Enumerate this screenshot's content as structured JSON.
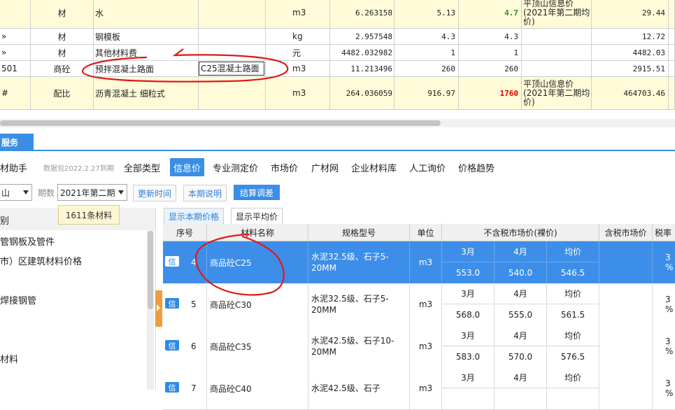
{
  "top_grid": {
    "rows": [
      {
        "code": "",
        "type": "材",
        "name": "水",
        "spec": "",
        "unit": "m3",
        "qty": "6.263158",
        "price1": "5.13",
        "price2": "4.7",
        "source": "平顶山信息价(2021年第二期均价)",
        "amount": "29.44",
        "highlight": true
      },
      {
        "code": "»",
        "type": "材",
        "name": "钢模板",
        "spec": "",
        "unit": "kg",
        "qty": "2.957548",
        "price1": "4.3",
        "price2": "4.3",
        "source": "",
        "amount": "12.72",
        "highlight": false
      },
      {
        "code": "»",
        "type": "材",
        "name": "其他材料费",
        "spec": "",
        "unit": "元",
        "qty": "4482.032982",
        "price1": "1",
        "price2": "1",
        "source": "",
        "amount": "4482.03",
        "highlight": false
      },
      {
        "code": "501",
        "type": "商砼",
        "name": "预拌混凝土路面",
        "spec": "C25混凝土路面",
        "unit": "m3",
        "qty": "11.213496",
        "price1": "260",
        "price2": "260",
        "source": "",
        "amount": "2915.51",
        "highlight": false
      },
      {
        "code": "#",
        "type": "配比",
        "name": "沥青混凝土 细粒式",
        "spec": "",
        "unit": "m3",
        "qty": "264.036059",
        "price1": "916.97",
        "price2": "1760",
        "source": "平顶山信息价(2021年第二期均价)",
        "amount": "464703.46",
        "highlight": true
      }
    ]
  },
  "service": {
    "tab_label": "服务",
    "helper_label": "材助手",
    "package_note": "数据包2022.2.27到期",
    "tabs": [
      "全部类型",
      "信息价",
      "专业测定价",
      "市场价",
      "广材网",
      "企业材料库",
      "人工询价",
      "价格趋势"
    ],
    "active_tab": "信息价",
    "period_label": "期数",
    "period_value": "2021年第二期",
    "region_value": "山",
    "update_time_btn": "更新时间",
    "period_note_btn": "本期说明",
    "settle_btn": "结算调差",
    "tooltip": "1611条材料",
    "category_header": "别",
    "tree_items": [
      "管钢板及管件",
      "市）区建筑材料价格",
      "焊接钢管",
      "材料"
    ],
    "subtabs": [
      "显示本期价格",
      "显示平均价"
    ],
    "active_subtab": "显示本期价格"
  },
  "price_grid": {
    "headers": {
      "seq": "序号",
      "name": "材料名称",
      "spec": "规格型号",
      "unit": "单位",
      "market_excl": "不含税市场价(裸价)",
      "market_incl": "含税市场价",
      "tax": "税率"
    },
    "month_labels": [
      "3月",
      "4月",
      "均价"
    ],
    "badge": "信",
    "rows": [
      {
        "seq": "4",
        "name": "商品砼C25",
        "spec": "水泥32.5级、石子5-20MM",
        "unit": "m3",
        "m3": "553.0",
        "m4": "540.0",
        "avg": "546.5",
        "tax": "3 %",
        "selected": true
      },
      {
        "seq": "5",
        "name": "商品砼C30",
        "spec": "水泥32.5级、石子5-20MM",
        "unit": "m3",
        "m3": "568.0",
        "m4": "555.0",
        "avg": "561.5",
        "tax": "3 %",
        "selected": false
      },
      {
        "seq": "6",
        "name": "商品砼C35",
        "spec": "水泥42.5级、石子10-20MM",
        "unit": "m3",
        "m3": "583.0",
        "m4": "570.0",
        "avg": "576.5",
        "tax": "3 %",
        "selected": false
      },
      {
        "seq": "7",
        "name": "商品砼C40",
        "spec": "水泥42.5级、石子",
        "unit": "m3",
        "m3": "",
        "m4": "",
        "avg": "",
        "tax": "3 %",
        "selected": false
      }
    ]
  }
}
